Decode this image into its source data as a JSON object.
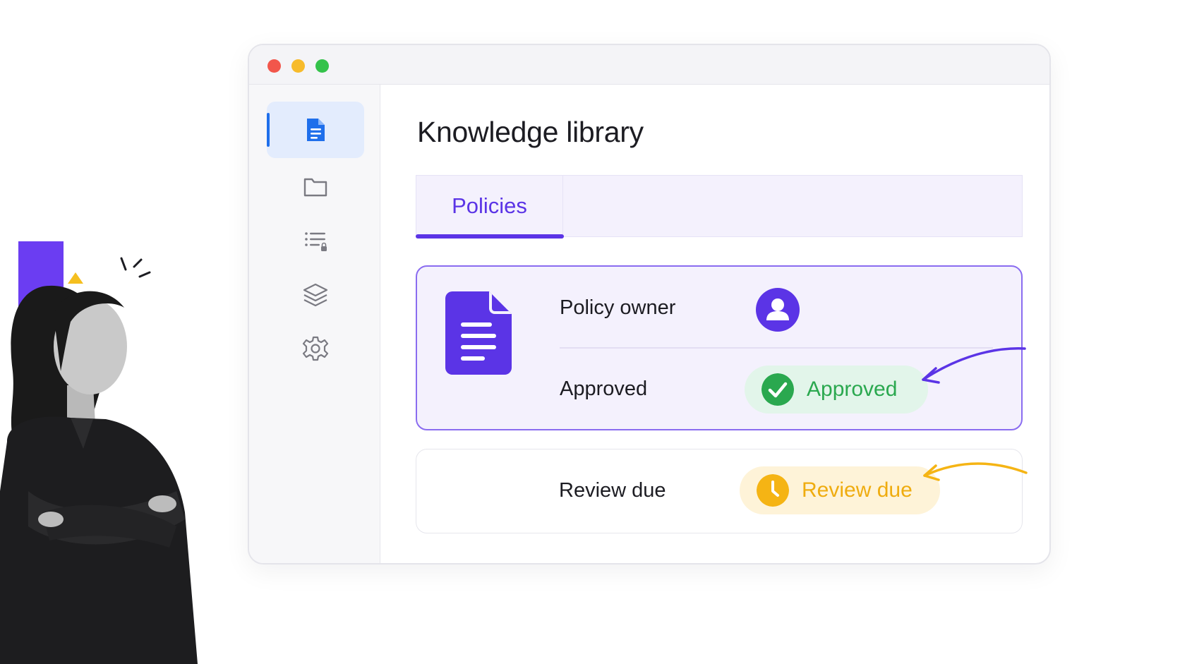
{
  "window": {
    "controls": [
      "close",
      "minimize",
      "maximize"
    ]
  },
  "sidebar": {
    "items": [
      {
        "icon": "document-icon",
        "active": true
      },
      {
        "icon": "folder-icon",
        "active": false
      },
      {
        "icon": "checklist-icon",
        "active": false
      },
      {
        "icon": "layers-icon",
        "active": false
      },
      {
        "icon": "gear-icon",
        "active": false
      }
    ]
  },
  "main": {
    "title": "Knowledge library",
    "tabs": [
      {
        "label": "Policies",
        "selected": true
      }
    ],
    "policy_card": {
      "icon": "document-icon",
      "owner_label": "Policy owner",
      "owner_icon": "user-avatar-icon",
      "approval_label": "Approved",
      "approval_badge": "Approved",
      "approval_badge_icon": "check-circle-icon"
    },
    "review_card": {
      "label": "Review due",
      "badge": "Review due",
      "badge_icon": "clock-icon"
    }
  },
  "colors": {
    "accent": "#5b34e6",
    "sidebar_active": "#1f6feb",
    "approved": "#2aa84f",
    "review": "#efac0f"
  }
}
